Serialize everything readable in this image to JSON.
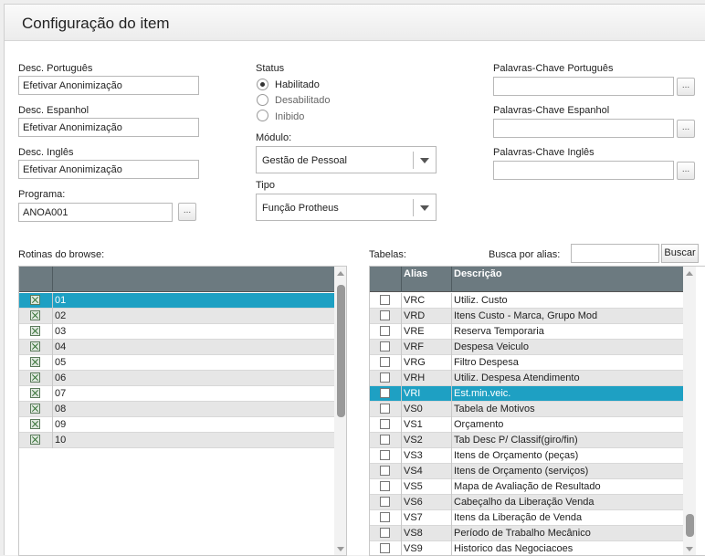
{
  "window": {
    "title": "Configuração do item"
  },
  "form": {
    "desc_pt_label": "Desc. Português",
    "desc_pt_value": "Efetivar Anonimização",
    "desc_es_label": "Desc. Espanhol",
    "desc_es_value": "Efetivar Anonimização",
    "desc_en_label": "Desc. Inglês",
    "desc_en_value": "Efetivar Anonimização",
    "programa_label": "Programa:",
    "programa_value": "ANOA001",
    "dots": "...",
    "status_label": "Status",
    "status_options": [
      "Habilitado",
      "Desabilitado",
      "Inibido"
    ],
    "modulo_label": "Módulo:",
    "modulo_value": "Gestão de Pessoal",
    "tipo_label": "Tipo",
    "tipo_value": "Função Protheus",
    "kw_pt_label": "Palavras-Chave Português",
    "kw_es_label": "Palavras-Chave Espanhol",
    "kw_en_label": "Palavras-Chave Inglês"
  },
  "browse": {
    "label": "Rotinas do browse:",
    "rows": [
      "01",
      "02",
      "03",
      "04",
      "05",
      "06",
      "07",
      "08",
      "09",
      "10"
    ]
  },
  "tables": {
    "label": "Tabelas:",
    "search_label": "Busca por alias:",
    "search_value": "",
    "search_button": "Buscar",
    "headers": {
      "alias": "Alias",
      "desc": "Descrição"
    },
    "rows": [
      {
        "alias": "VRC",
        "desc": "Utiliz. Custo"
      },
      {
        "alias": "VRD",
        "desc": "Itens Custo - Marca, Grupo Mod"
      },
      {
        "alias": "VRE",
        "desc": "Reserva Temporaria"
      },
      {
        "alias": "VRF",
        "desc": "Despesa Veiculo"
      },
      {
        "alias": "VRG",
        "desc": "Filtro Despesa"
      },
      {
        "alias": "VRH",
        "desc": "Utiliz. Despesa Atendimento"
      },
      {
        "alias": "VRI",
        "desc": "Est.min.veic."
      },
      {
        "alias": "VS0",
        "desc": "Tabela de Motivos"
      },
      {
        "alias": "VS1",
        "desc": "Orçamento"
      },
      {
        "alias": "VS2",
        "desc": "Tab Desc P/ Classif(giro/fin)"
      },
      {
        "alias": "VS3",
        "desc": "Itens de Orçamento (peças)"
      },
      {
        "alias": "VS4",
        "desc": "Itens de Orçamento (serviços)"
      },
      {
        "alias": "VS5",
        "desc": "Mapa de Avaliação de Resultado"
      },
      {
        "alias": "VS6",
        "desc": "Cabeçalho da Liberação Venda"
      },
      {
        "alias": "VS7",
        "desc": "Itens da Liberação de Venda"
      },
      {
        "alias": "VS8",
        "desc": "Período de Trabalho Mecânico"
      },
      {
        "alias": "VS9",
        "desc": "Historico das Negociacoes"
      }
    ]
  },
  "colors": {
    "selection": "#1ea0c3",
    "header": "#6c7a80"
  },
  "icons": {
    "check": "check-icon",
    "dropdown": "chevron-down-icon"
  }
}
